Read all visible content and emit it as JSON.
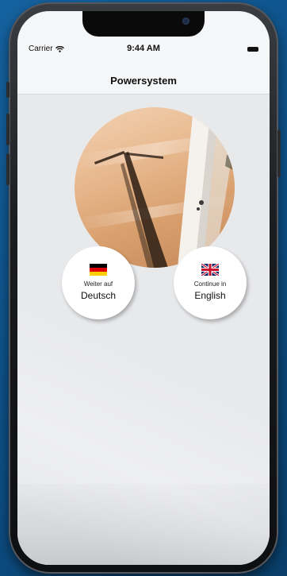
{
  "status_bar": {
    "carrier": "Carrier",
    "time": "9:44 AM"
  },
  "nav": {
    "title": "Powersystem"
  },
  "hero_image": {
    "subject": "wind turbine shadow on sand"
  },
  "languages": [
    {
      "small_label": "Weiter auf",
      "big_label": "Deutsch",
      "flag": "germany-flag"
    },
    {
      "small_label": "Continue in",
      "big_label": "English",
      "flag": "uk-flag"
    }
  ],
  "colors": {
    "background_blue": "#0d4f85",
    "screen_bg": "#e8e9eb",
    "nav_bg": "#f5f6f7"
  }
}
